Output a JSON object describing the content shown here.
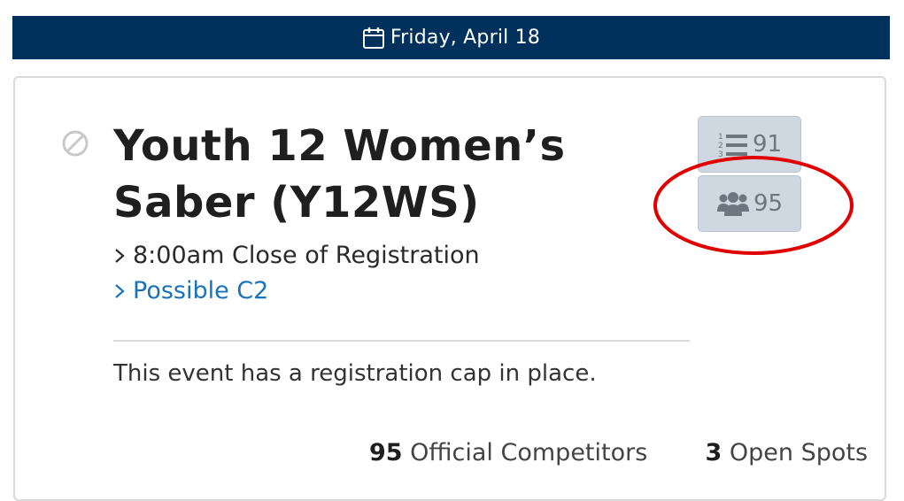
{
  "header": {
    "date_label": "Friday, April 18",
    "calendar_icon": "calendar-icon"
  },
  "event": {
    "title_line1": "Youth 12 Women’s",
    "title_line2": "Saber (Y12WS)",
    "status_icon": "ban-icon",
    "close_label": "8:00am Close of Registration",
    "rating_link": "Possible C2",
    "cap_note": "This event has a registration cap in place.",
    "official_count": "95",
    "official_label": "Official Competitors",
    "open_count": "3",
    "open_label": "Open Spots"
  },
  "buttons": {
    "rankings_count": "91",
    "rankings_icon": "ordered-list-icon",
    "competitors_count": "95",
    "competitors_icon": "users-icon"
  },
  "colors": {
    "header_bg": "#00305c",
    "link": "#1a73b8",
    "button_bg": "#cfd8e0",
    "highlight_circle": "#e00000"
  }
}
